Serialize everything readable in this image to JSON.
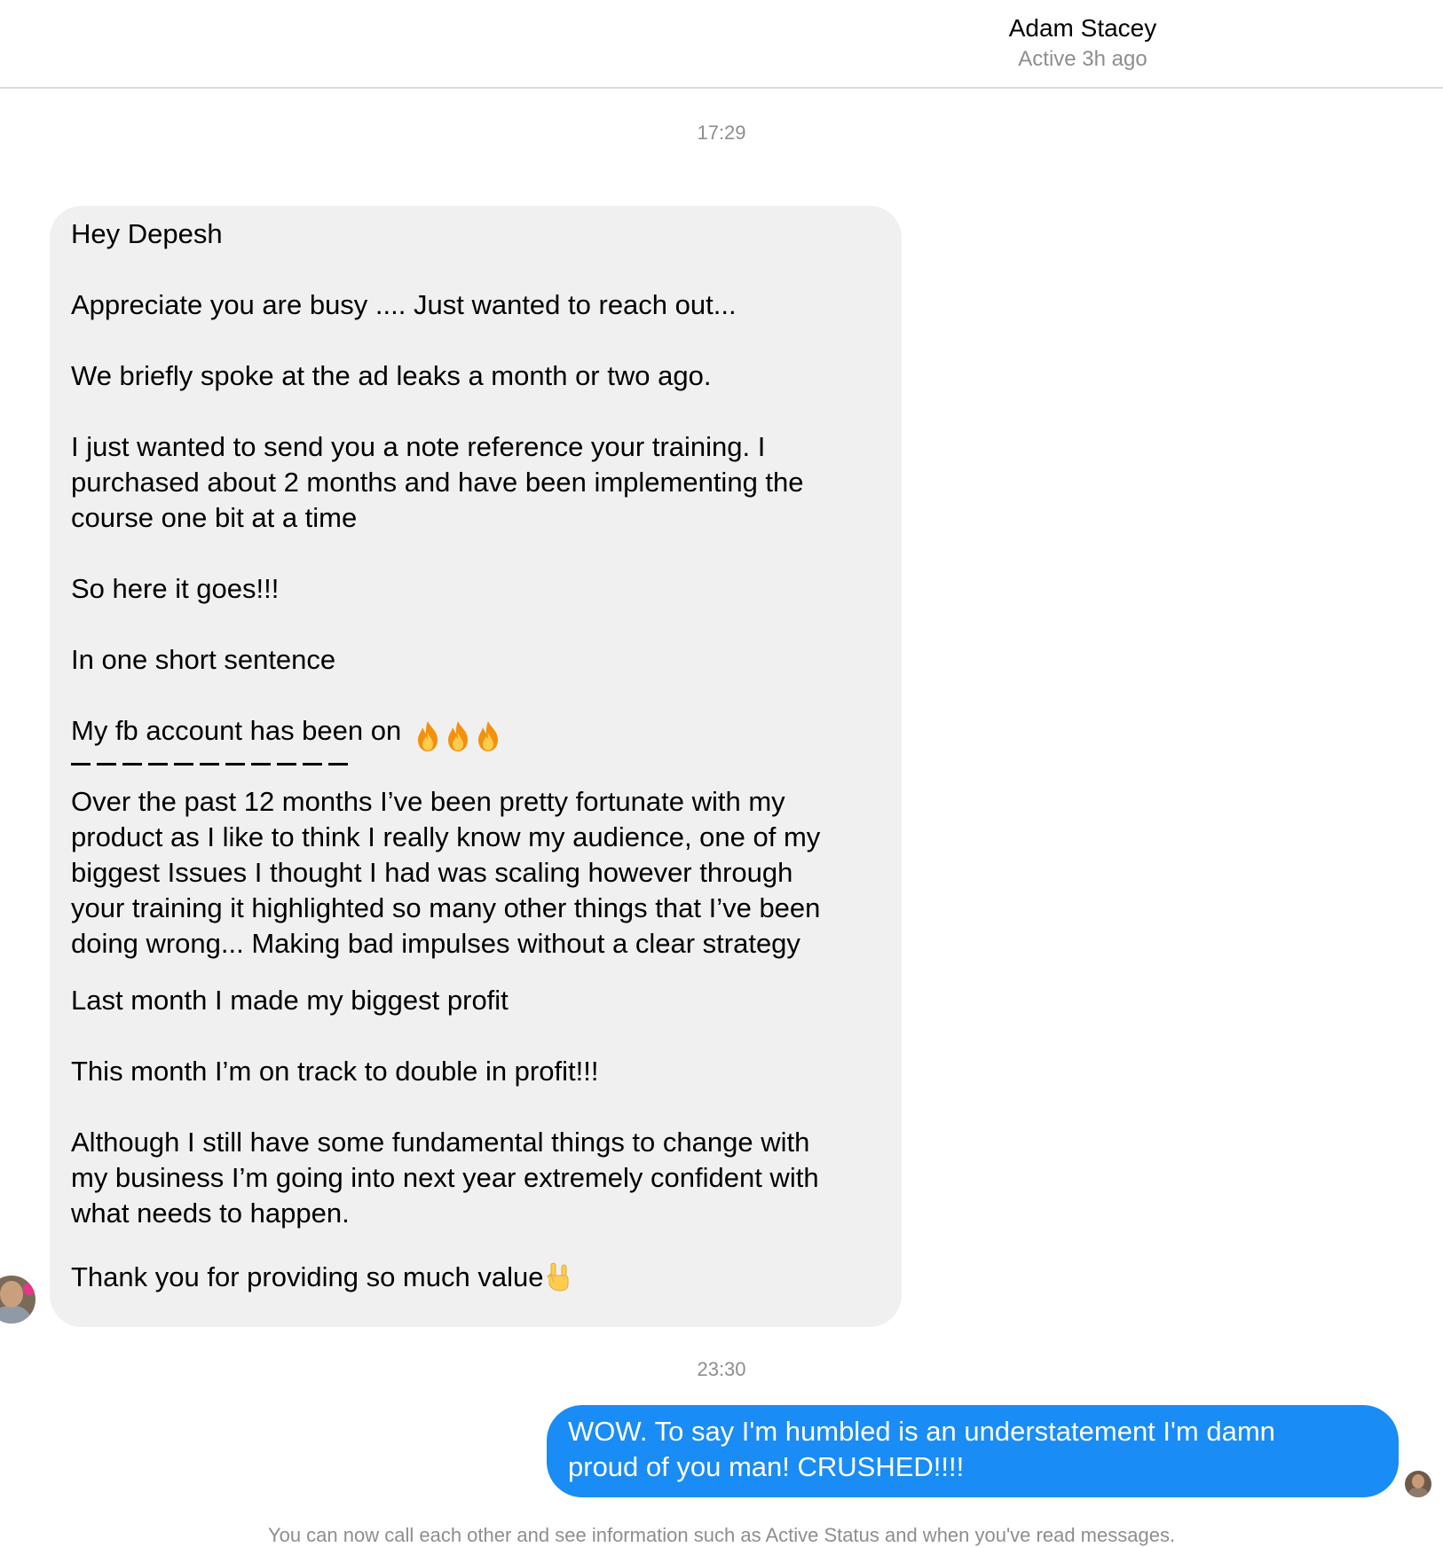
{
  "header": {
    "contact_name": "Adam Stacey",
    "contact_status": "Active 3h ago"
  },
  "timestamps": {
    "first": "17:29",
    "second": "23:30"
  },
  "incoming_message": {
    "greeting": "Hey Depesh",
    "p1": "Appreciate you are busy .... Just wanted to reach out...",
    "p2": "We briefly spoke at the ad leaks a month or two ago.",
    "p3_l1": "I just wanted to send you a note reference your training. I",
    "p3_l2": "purchased about 2 months and have been implementing the",
    "p3_l3": "course one bit at a time",
    "p4": "So here it goes!!!",
    "p5": "In one short sentence",
    "p6": "My fb account has been on",
    "p6_emoji": "fire-icon x3",
    "p7_l1": "Over the past 12 months I’ve been pretty fortunate with my",
    "p7_l2": "product as I like to think I really know my audience, one of my",
    "p7_l3": "biggest Issues I thought I had was scaling however through",
    "p7_l4": "your training it highlighted so many other things that I’ve been",
    "p7_l5": "doing wrong... Making bad impulses without a clear strategy",
    "p8": "Last month I made my biggest profit",
    "p9": "This month I’m on track to double in profit!!!",
    "p10_l1": "Although I still have some fundamental things to change with",
    "p10_l2": "my business I’m going into next year extremely confident with",
    "p10_l3": "what needs to happen.",
    "p11": "Thank you for providing so much value",
    "p11_emoji": "rock-on-hand-icon"
  },
  "outgoing_message": {
    "l1": "WOW. To say I'm humbled is an understatement I'm damn",
    "l2": "proud of you man! CRUSHED!!!!"
  },
  "footer_note": "You can now call each other and see information such as Active Status and when you've read messages.",
  "colors": {
    "incoming_bubble": "#f0f0f0",
    "outgoing_bubble": "#1a8cf5",
    "muted_text": "#8e8e8e",
    "divider": "#dcdcdc"
  }
}
